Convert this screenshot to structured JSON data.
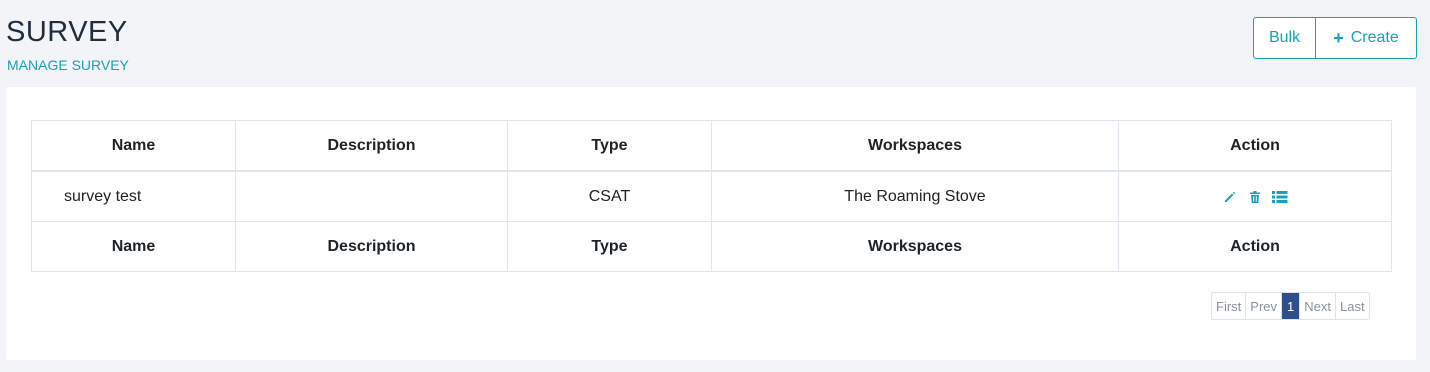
{
  "header": {
    "title": "SURVEY",
    "subtitle": "MANAGE SURVEY",
    "bulk_label": "Bulk",
    "create_label": "Create",
    "accent_color": "#17a2b8"
  },
  "table": {
    "columns": [
      "Name",
      "Description",
      "Type",
      "Workspaces",
      "Action"
    ],
    "rows": [
      {
        "name": "survey test",
        "description": "",
        "type": "CSAT",
        "workspaces": "The Roaming Stove",
        "actions": [
          "pencil-icon",
          "trash-icon",
          "list-icon"
        ]
      }
    ]
  },
  "pagination": {
    "first": "First",
    "prev": "Prev",
    "current": "1",
    "next": "Next",
    "last": "Last",
    "active_color": "#2d4f8e"
  }
}
